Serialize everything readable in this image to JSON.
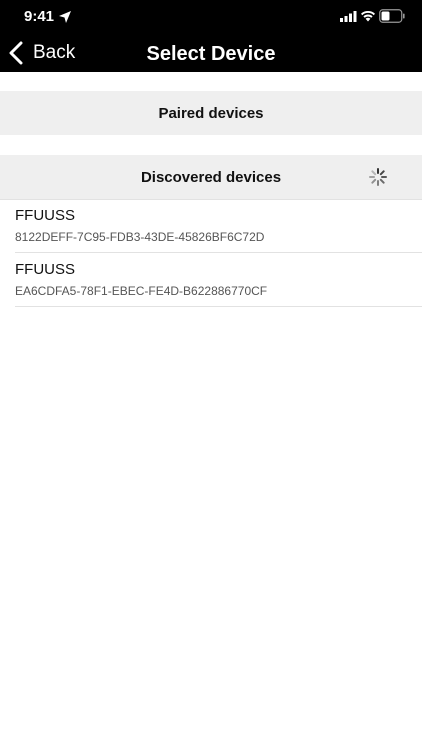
{
  "status_bar": {
    "time": "9:41"
  },
  "nav": {
    "back_label": "Back",
    "title": "Select Device"
  },
  "sections": {
    "paired_title": "Paired devices",
    "discovered_title": "Discovered devices"
  },
  "devices": [
    {
      "name": "FFUUSS",
      "id": "8122DEFF-7C95-FDB3-43DE-45826BF6C72D"
    },
    {
      "name": "FFUUSS",
      "id": "EA6CDFA5-78F1-EBEC-FE4D-B622886770CF"
    }
  ],
  "icons": {
    "location": "location-arrow-icon",
    "signal": "cellular-signal-icon",
    "wifi": "wifi-icon",
    "battery": "battery-icon",
    "back": "chevron-left-icon",
    "spinner": "activity-spinner-icon"
  },
  "colors": {
    "header_bg": "#000000",
    "section_bg": "#efefef",
    "divider": "#e2e2e2"
  }
}
